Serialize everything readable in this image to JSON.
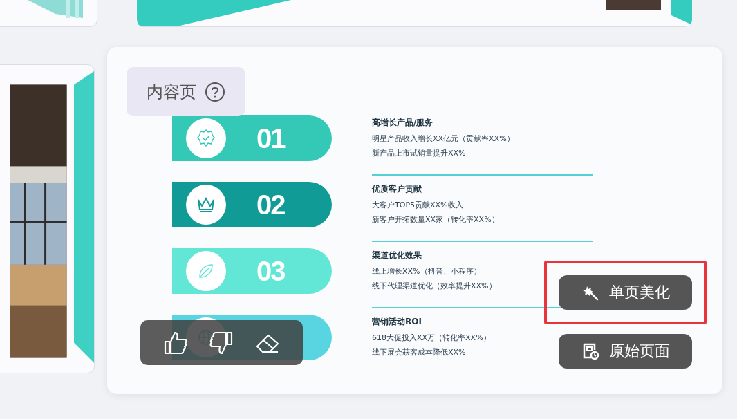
{
  "page_label": {
    "text": "内容页"
  },
  "items": [
    {
      "number": "01",
      "color": "#33c9b6",
      "heading": "高增长产品/服务",
      "lines": [
        "明星产品收入增长XX亿元（贡献率XX%）",
        "新产品上市试销量提升XX%"
      ]
    },
    {
      "number": "02",
      "color": "#109b97",
      "heading": "优质客户贡献",
      "lines": [
        "大客户TOP5贡献XX%收入",
        "新客户开拓数量XX家（转化率XX%）"
      ]
    },
    {
      "number": "03",
      "color": "#62e6d6",
      "heading": "渠道优化效果",
      "lines": [
        "线上增长XX%（抖音、小程序）",
        "线下代理渠道优化（效率提升XX%）"
      ]
    },
    {
      "color": "#58d5e0",
      "heading": "营销活动ROI",
      "lines": [
        "618大促投入XX万（转化率XX%）",
        "线下展会获客成本降低XX%"
      ]
    }
  ],
  "buttons": [
    {
      "label": "单页美化",
      "highlighted": true
    },
    {
      "label": "原始页面",
      "highlighted": false
    }
  ]
}
